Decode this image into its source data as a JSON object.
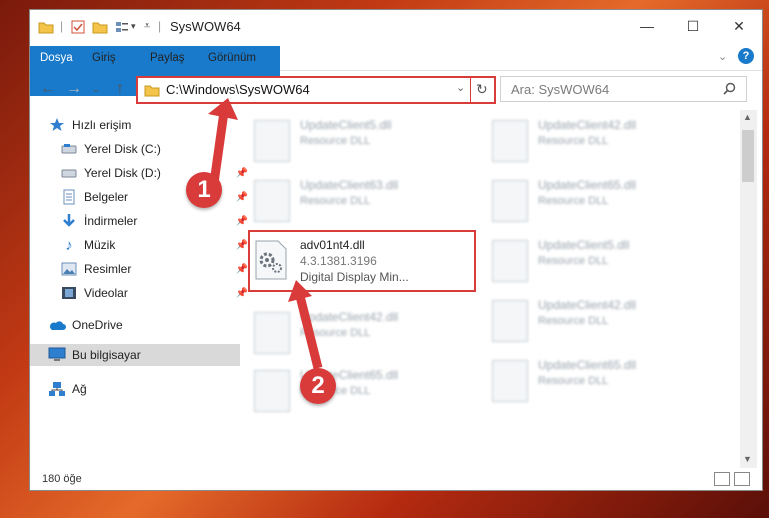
{
  "window": {
    "title": "SysWOW64",
    "controls": {
      "minimize": "—",
      "maximize": "☐",
      "close": "✕"
    }
  },
  "ribbon": {
    "tabs": [
      "Dosya",
      "Giriş",
      "Paylaş",
      "Görünüm"
    ],
    "help": "?"
  },
  "address": {
    "path": "C:\\Windows\\SysWOW64",
    "search_placeholder": "Ara: SysWOW64"
  },
  "sidebar": {
    "items": [
      {
        "label": "Hızlı erişim",
        "icon": "star-icon",
        "pinned": false
      },
      {
        "label": "Yerel Disk (C:)",
        "icon": "drive-icon",
        "pinned": true
      },
      {
        "label": "Yerel Disk (D:)",
        "icon": "drive-icon",
        "pinned": true
      },
      {
        "label": "Belgeler",
        "icon": "documents-icon",
        "pinned": true
      },
      {
        "label": "İndirmeler",
        "icon": "download-icon",
        "pinned": true
      },
      {
        "label": "Müzik",
        "icon": "music-icon",
        "pinned": true
      },
      {
        "label": "Resimler",
        "icon": "pictures-icon",
        "pinned": true
      },
      {
        "label": "Videolar",
        "icon": "video-icon",
        "pinned": true
      },
      {
        "label": "OneDrive",
        "icon": "cloud-icon",
        "pinned": false
      },
      {
        "label": "Bu bilgisayar",
        "icon": "computer-icon",
        "pinned": false
      },
      {
        "label": "Ağ",
        "icon": "network-icon",
        "pinned": false
      }
    ]
  },
  "files": {
    "left": [
      {
        "name": "UpdateClient5.dll",
        "desc": "Resource DLL"
      },
      {
        "name": "UpdateClient63.dll",
        "desc": "Resource DLL"
      },
      {
        "name": "adv01nt4.dll",
        "version": "4.3.1381.3196",
        "desc": "Digital Display Min..."
      },
      {
        "name": "UpdateClient42.dll",
        "desc": "Resource DLL"
      },
      {
        "name": "UpdateClient65.dll",
        "desc": "Resource DLL"
      }
    ],
    "right": [
      {
        "name": "UpdateClient42.dll",
        "desc": "Resource DLL"
      },
      {
        "name": "UpdateClient65.dll",
        "desc": "Resource DLL"
      },
      {
        "name": "UpdateClient5.dll",
        "desc": "Resource DLL"
      },
      {
        "name": "UpdateClient42.dll",
        "desc": "Resource DLL"
      },
      {
        "name": "UpdateClient65.dll",
        "desc": "Resource DLL"
      }
    ]
  },
  "status": {
    "count": "180 öğe"
  },
  "annotations": {
    "step1": "1",
    "step2": "2"
  },
  "colors": {
    "accent": "#1979ca",
    "highlight": "#d93a3a"
  }
}
